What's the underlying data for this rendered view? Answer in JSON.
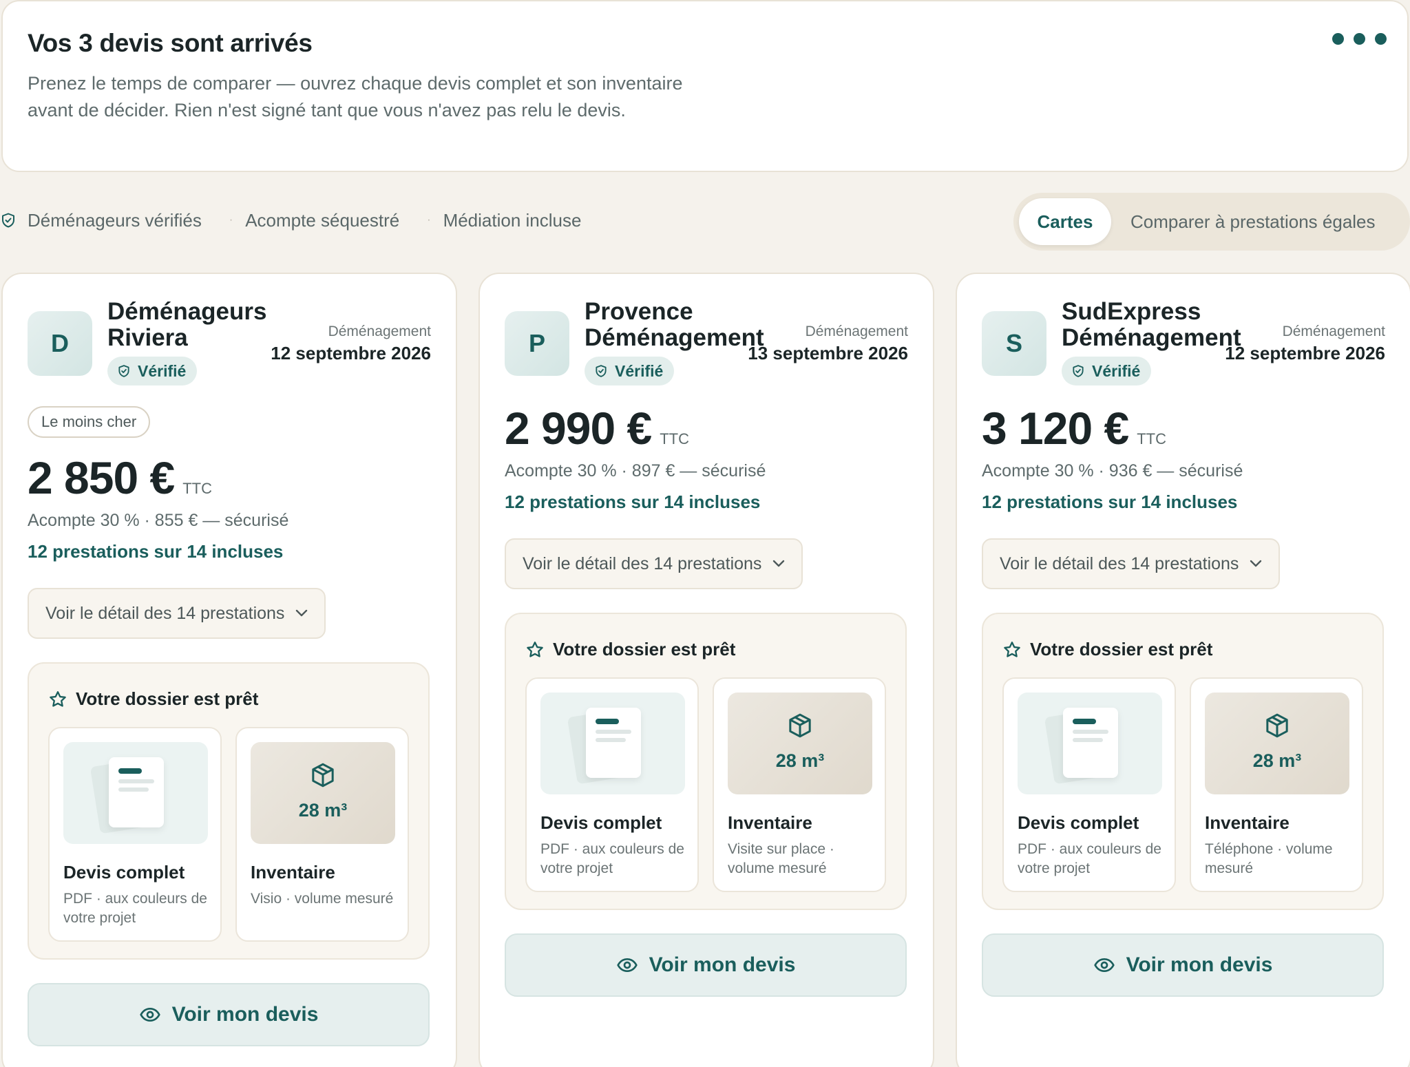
{
  "header": {
    "title": "Vos 3 devis sont arrivés",
    "subtitle": "Prenez le temps de comparer — ouvrez chaque devis complet et son inventaire avant de décider. Rien n'est signé tant que vous n'avez pas relu le devis."
  },
  "trust": {
    "items": [
      "Déménageurs vérifiés",
      "Acompte séquestré",
      "Médiation incluse"
    ],
    "separator": "·"
  },
  "view_toggle": {
    "active": "Cartes",
    "inactive": "Comparer à prestations égales"
  },
  "common": {
    "verified_label": "Vérifié",
    "move_label": "Déménagement",
    "ttc": "TTC",
    "detail_button": "Voir le détail des 14 prestations",
    "dossier_title": "Votre dossier est prêt",
    "doc_title": "Devis complet",
    "doc_sub": "PDF · aux couleurs de votre projet",
    "inv_title": "Inventaire",
    "see_button": "Voir mon devis"
  },
  "quotes": [
    {
      "initial": "D",
      "company": "Déménageurs Riviera",
      "date": "12 septembre 2026",
      "badge": "Le moins cher",
      "price": "2 850 €",
      "deposit": "Acompte 30 % · 855 € — sécurisé",
      "included": "12 prestations sur 14 incluses",
      "volume": "28 m³",
      "inv_sub": "Visio · volume mesuré"
    },
    {
      "initial": "P",
      "company": "Provence Déménagement",
      "date": "13 septembre 2026",
      "badge": "",
      "price": "2 990 €",
      "deposit": "Acompte 30 % · 897 € — sécurisé",
      "included": "12 prestations sur 14 incluses",
      "volume": "28 m³",
      "inv_sub": "Visite sur place · volume mesuré"
    },
    {
      "initial": "S",
      "company": "SudExpress Déménagement",
      "date": "12 septembre 2026",
      "badge": "",
      "price": "3 120 €",
      "deposit": "Acompte 30 % · 936 € — sécurisé",
      "included": "12 prestations sur 14 incluses",
      "volume": "28 m³",
      "inv_sub": "Téléphone · volume mesuré"
    }
  ],
  "colors": {
    "accent": "#1a5e5c",
    "background": "#f5f2ec",
    "card": "#ffffff"
  },
  "icons": {
    "menu": "more-dots-icon",
    "trust": "shield-check-icon",
    "verified": "shield-check-icon",
    "dossier": "star-icon",
    "inventory": "cube-icon",
    "detail": "chevron-down-icon",
    "see": "eye-icon"
  }
}
